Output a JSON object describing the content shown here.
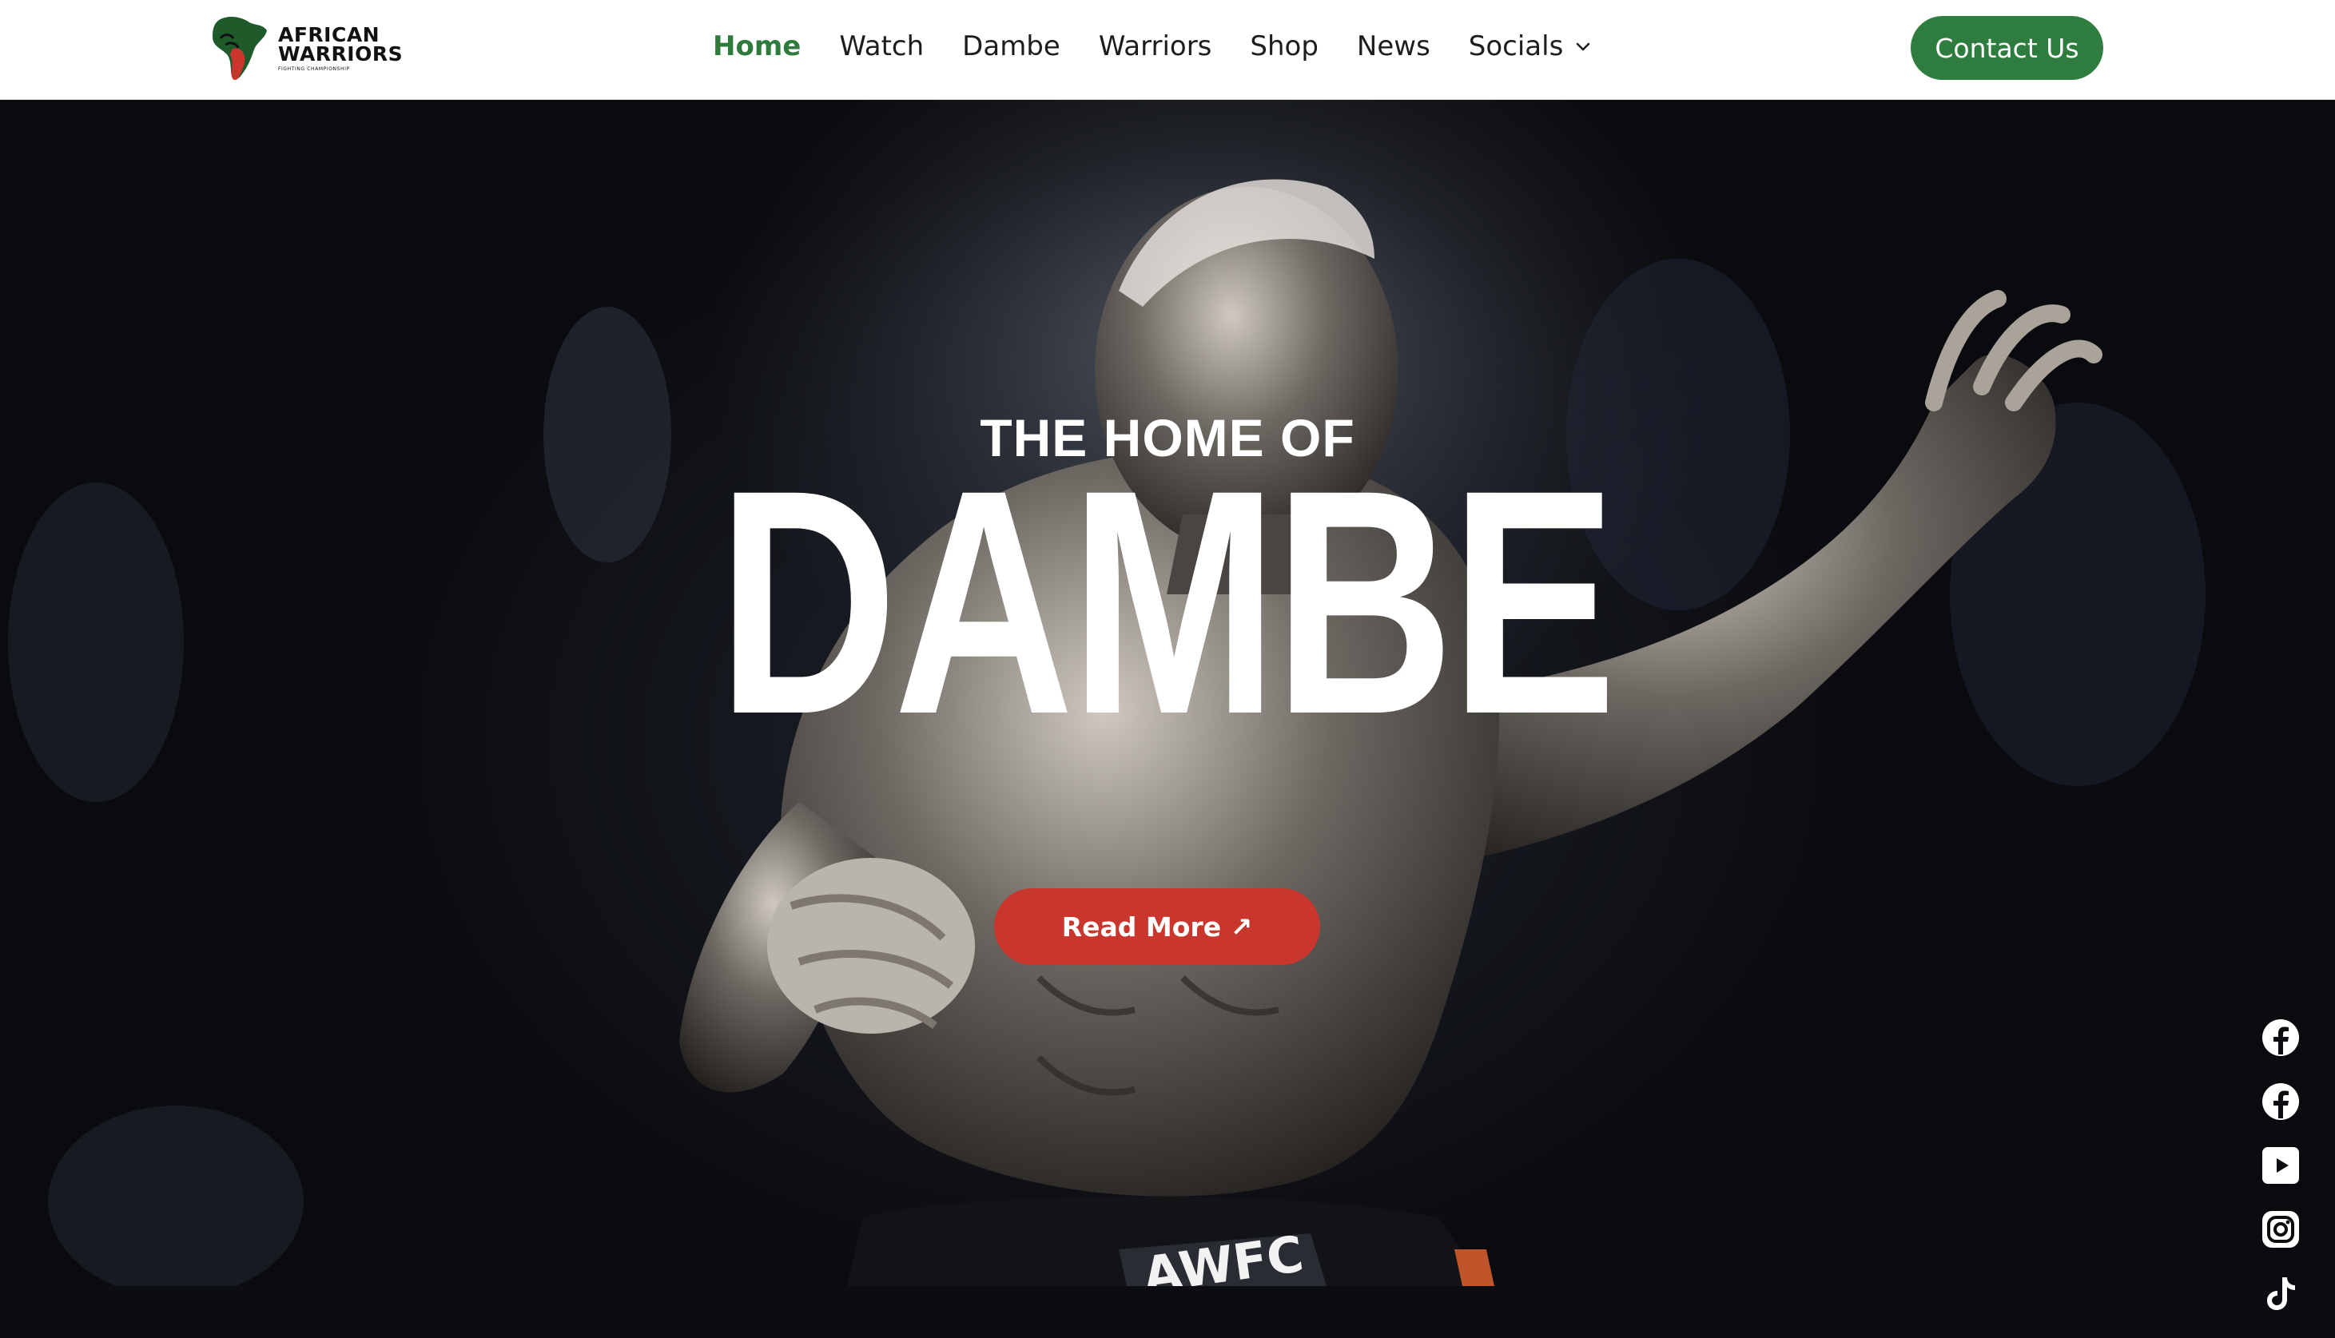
{
  "brand": {
    "logo_line1": "AFRICAN",
    "logo_line2": "WARRIORS",
    "logo_line3": "FIGHTING CHAMPIONSHIP"
  },
  "nav": {
    "items": [
      {
        "label": "Home"
      },
      {
        "label": "Watch"
      },
      {
        "label": "Dambe"
      },
      {
        "label": "Warriors"
      },
      {
        "label": "Shop"
      },
      {
        "label": "News"
      },
      {
        "label": "Socials"
      }
    ],
    "contact_label": "Contact Us"
  },
  "hero": {
    "kicker": "THE HOME OF",
    "headline": "DAMBE",
    "cta_label": "Read More ↗",
    "shorts_text": "AWFC"
  },
  "social": [
    {
      "icon": "facebook-icon"
    },
    {
      "icon": "facebook-icon"
    },
    {
      "icon": "youtube-icon"
    },
    {
      "icon": "instagram-icon"
    },
    {
      "icon": "tiktok-icon"
    }
  ],
  "colors": {
    "accent_green": "#2e7d3e",
    "cta_red": "#c9362e",
    "nav_text": "#1d1d1d",
    "hero_bg": "#0c0d10"
  }
}
